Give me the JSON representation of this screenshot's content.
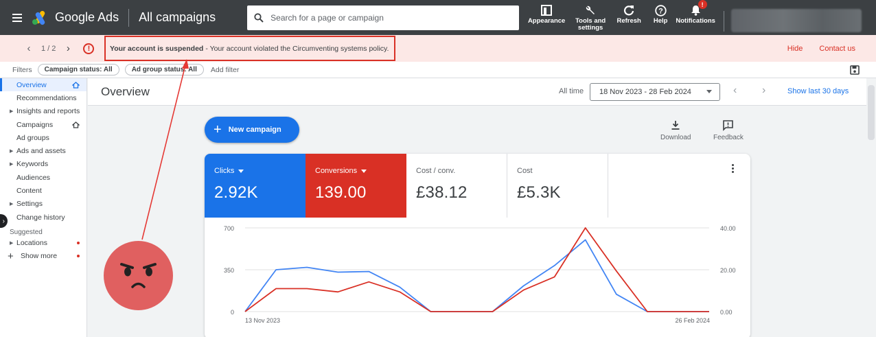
{
  "header": {
    "product_name": "Google Ads",
    "page_name": "All campaigns",
    "search_placeholder": "Search for a page or campaign",
    "tools": [
      {
        "label": "Appearance",
        "icon": "appearance-icon"
      },
      {
        "label": "Tools and settings",
        "icon": "wrench-icon"
      },
      {
        "label": "Refresh",
        "icon": "refresh-icon"
      },
      {
        "label": "Help",
        "icon": "help-icon"
      },
      {
        "label": "Notifications",
        "icon": "bell-icon",
        "badge": "!"
      }
    ]
  },
  "banner": {
    "pager": "1 / 2",
    "title": "Your account is suspended",
    "message": "- Your account violated the Circumventing systems policy.",
    "hide_label": "Hide",
    "contact_label": "Contact us"
  },
  "filters": {
    "label": "Filters",
    "chips": [
      "Campaign status: All",
      "Ad group status: All"
    ],
    "add_filter": "Add filter"
  },
  "sidebar": {
    "items": [
      {
        "label": "Overview",
        "active": true,
        "home": true
      },
      {
        "label": "Recommendations"
      },
      {
        "label": "Insights and reports",
        "expandable": true
      },
      {
        "label": "Campaigns",
        "home": true
      },
      {
        "label": "Ad groups"
      },
      {
        "label": "Ads and assets",
        "expandable": true
      },
      {
        "label": "Keywords",
        "expandable": true
      },
      {
        "label": "Audiences"
      },
      {
        "label": "Content"
      },
      {
        "label": "Settings",
        "expandable": true
      },
      {
        "label": "Change history"
      }
    ],
    "suggested_label": "Suggested",
    "suggested_items": [
      {
        "label": "Locations",
        "expandable": true,
        "dot": true
      },
      {
        "label": "Show more",
        "dot": true
      }
    ]
  },
  "overview": {
    "title": "Overview",
    "time_label": "All time",
    "date_range": "18 Nov 2023 - 28 Feb 2024",
    "show_last": "Show last 30 days",
    "new_campaign": "New campaign",
    "download": "Download",
    "feedback": "Feedback"
  },
  "metrics": [
    {
      "label": "Clicks",
      "value": "2.92K",
      "color": "#1a73e8",
      "dropdown": true
    },
    {
      "label": "Conversions",
      "value": "139.00",
      "color": "#d93025",
      "dropdown": true
    },
    {
      "label": "Cost / conv.",
      "value": "£38.12"
    },
    {
      "label": "Cost",
      "value": "£5.3K"
    }
  ],
  "chart_data": {
    "type": "line",
    "x_start_label": "13 Nov 2023",
    "x_end_label": "26 Feb 2024",
    "left_ticks": [
      "700",
      "350",
      "0"
    ],
    "right_ticks": [
      "40.00",
      "20.00",
      "0.00"
    ],
    "ylim_left": [
      0,
      700
    ],
    "ylim_right": [
      0,
      40
    ],
    "series": [
      {
        "name": "Clicks",
        "axis": "left",
        "color": "#4285f4",
        "values": [
          0,
          350,
          370,
          330,
          335,
          205,
          0,
          0,
          0,
          215,
          385,
          600,
          145,
          0,
          0,
          0
        ]
      },
      {
        "name": "Conversions",
        "axis": "right",
        "color": "#d93025",
        "values": [
          0,
          11,
          11,
          9.4,
          14.2,
          9.4,
          0,
          0,
          0,
          10.3,
          16.6,
          40,
          19.4,
          0,
          0,
          0
        ]
      }
    ]
  },
  "annotation": {
    "arrow_color": "#e53935",
    "emoji": "angry-face"
  }
}
